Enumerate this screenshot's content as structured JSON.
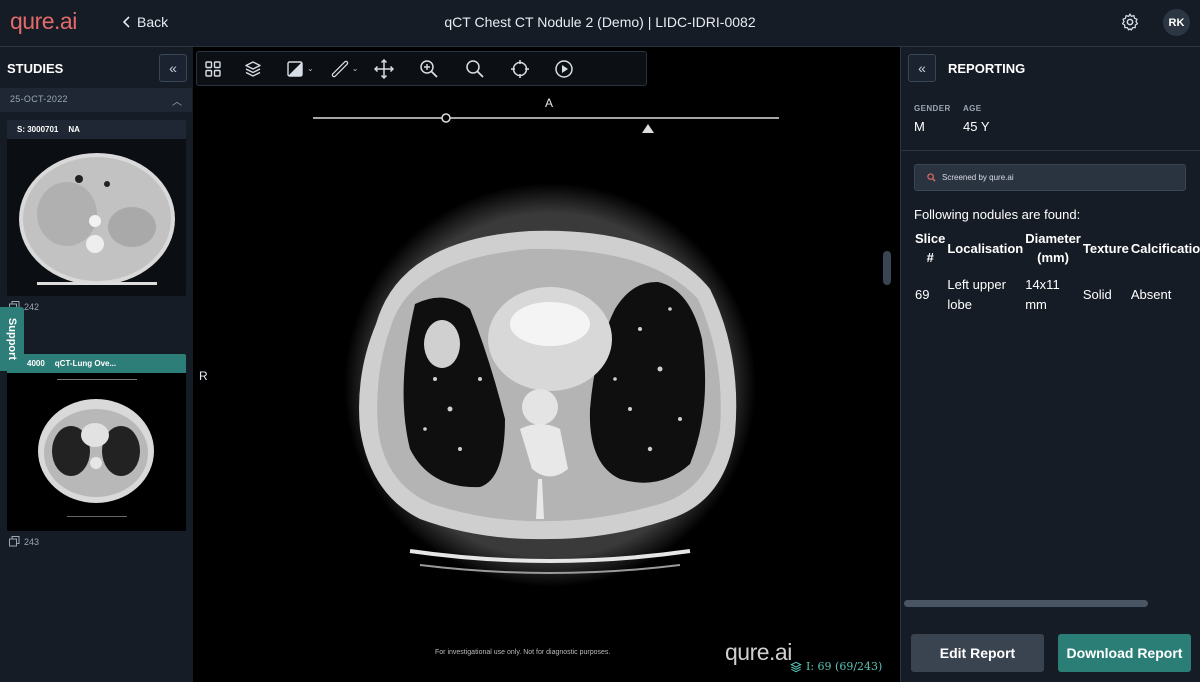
{
  "brand": {
    "logo": "qure.ai"
  },
  "header": {
    "back_label": "Back",
    "title": "qCT Chest CT Nodule 2 (Demo) | LIDC-IDRI-0082",
    "user_initials": "RK"
  },
  "studies": {
    "title": "STUDIES",
    "date": "25-OCT-2022",
    "series": [
      {
        "id": "S: 3000701",
        "desc": "NA",
        "count": "242"
      },
      {
        "id": "4000",
        "desc": "qCT-Lung Ove...",
        "count": "243"
      }
    ],
    "support_label": "Support"
  },
  "viewer": {
    "orientation_top": "A",
    "orientation_left": "R",
    "disclaimer": "For investigational use only. Not for diagnostic purposes.",
    "watermark": "qure.ai",
    "slice_info": "I: 69 (69/243)",
    "tools": [
      "layout-icon",
      "layers-icon",
      "contrast-icon",
      "ruler-icon",
      "pan-icon",
      "zoom-in-icon",
      "zoom-icon",
      "crosshair-icon",
      "play-icon"
    ]
  },
  "report": {
    "title": "REPORTING",
    "gender_label": "GENDER",
    "gender": "M",
    "age_label": "AGE",
    "age": "45 Y",
    "screened": "Screened by qure.ai",
    "found_text": "Following nodules are found:",
    "columns": {
      "slice": "Slice #",
      "loc": "Localisation",
      "diam": "Diameter (mm)",
      "texture": "Texture",
      "calc": "Calcification"
    },
    "rows": [
      {
        "slice": "69",
        "loc": "Left upper lobe",
        "diam": "14x11 mm",
        "texture": "Solid",
        "calc": "Absent"
      }
    ],
    "edit_label": "Edit Report",
    "download_label": "Download Report"
  },
  "colors": {
    "accent": "#2b7e76",
    "logo": "#e46a6a",
    "background": "#151c26"
  }
}
